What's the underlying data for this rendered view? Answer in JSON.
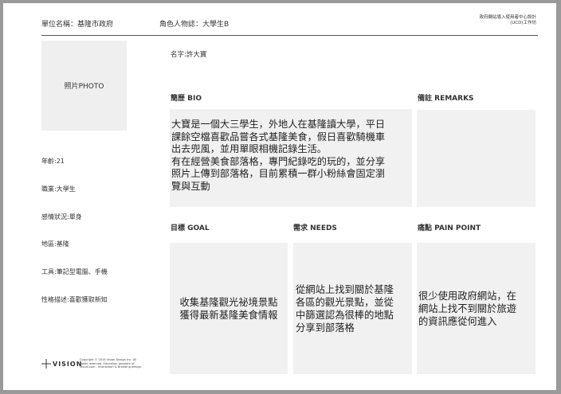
{
  "header": {
    "unit": "單位名稱：基隆市政府",
    "persona": "角色人物誌：大學生B",
    "org_line1": "政府網站導入使用者中心設計",
    "org_line2": "(UCD)工作坊"
  },
  "photo": {
    "label": "照片PHOTO"
  },
  "name": "名字:許大寶",
  "profile": {
    "age": "年齡:21",
    "job": "職業:大學生",
    "relationship": "感情狀況:單身",
    "location": "地區:基隆",
    "tools": "工具:筆記型電腦、手機",
    "personality": "性格描述:喜歡獲取新知"
  },
  "bio": {
    "title": "簡歷 BIO",
    "text": "大寶是一個大三學生，外地人在基隆讀大學，平日\n課餘空檔喜歡品嘗各式基隆美食，假日喜歡騎機車\n出去兜風，並用單眼相機記錄生活。\n有在經營美食部落格，專門紀錄吃的玩的，並分享\n照片上傳到部落格，目前累積一群小粉絲會固定瀏\n覽與互動"
  },
  "remarks": {
    "title": "備註 REMARKS"
  },
  "goal": {
    "title": "目標 GOAL",
    "text": "收集基隆觀光祕境景點\n獲得最新基隆美食情報"
  },
  "needs": {
    "title": "需求 NEEDS",
    "text": "從網站上找到關於基隆\n各區的觀光景點，並從\n中篩選認為很棒的地點\n分享到部落格"
  },
  "pain_point": {
    "title": "痛點 PAIN POINT",
    "text": "很少使用政府網站，在\n網站上找不到關於旅遊\n的資訊應從何進入"
  },
  "footer": {
    "logo_text": "VISION",
    "copyright": "Copyright © 2016 Vision Design Inc. All rights reserved. Education program of Visual.com - Interaction & Branding design."
  }
}
